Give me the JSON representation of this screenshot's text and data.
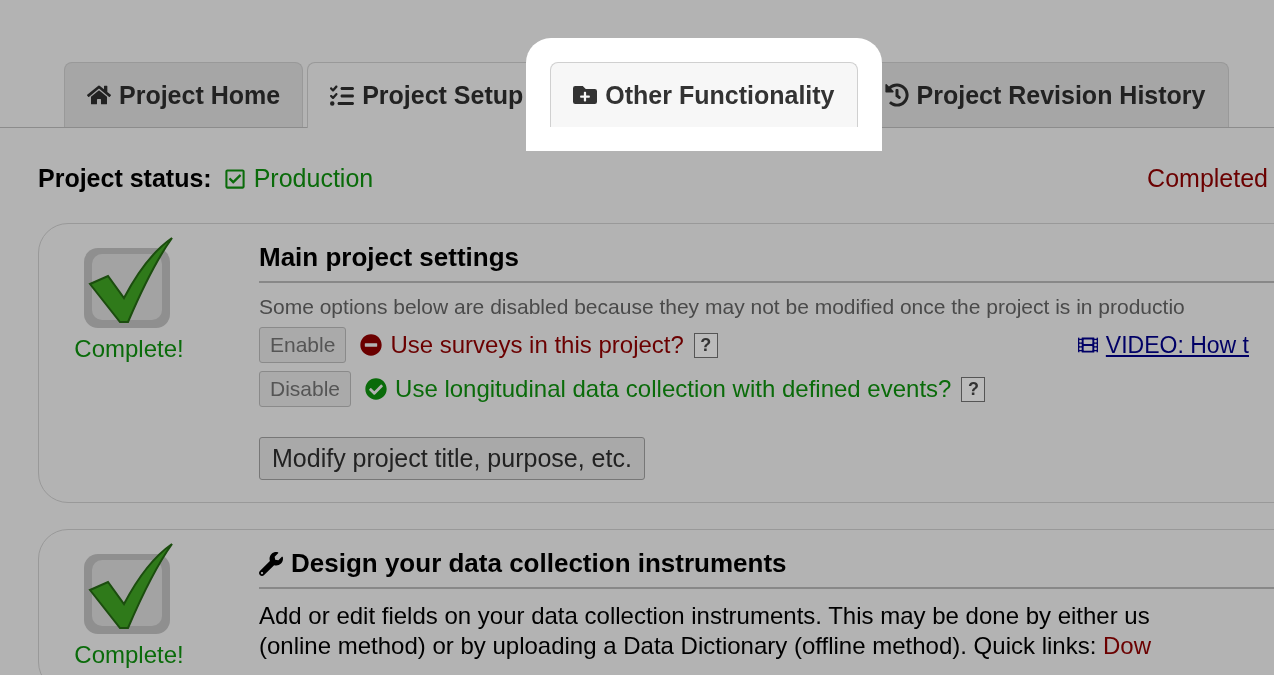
{
  "tabs": [
    {
      "label": "Project Home",
      "selected": false,
      "highlighted": false
    },
    {
      "label": "Project Setup",
      "selected": true,
      "highlighted": false
    },
    {
      "label": "Other Functionality",
      "selected": false,
      "highlighted": true
    },
    {
      "label": "Project Revision History",
      "selected": false,
      "highlighted": false
    }
  ],
  "project_status": {
    "label": "Project status:",
    "value": "Production"
  },
  "completed_label": "Completed",
  "main_settings": {
    "status": "Complete!",
    "title": "Main project settings",
    "note": "Some options below are disabled because they may not be modified once the project is in productio",
    "options": [
      {
        "button": "Enable",
        "disabled": true,
        "enabled": false,
        "text": "Use surveys in this project?",
        "help": "?"
      },
      {
        "button": "Disable",
        "disabled": true,
        "enabled": true,
        "text": "Use longitudinal data collection with defined events?",
        "help": "?"
      }
    ],
    "video_link": "VIDEO: How t",
    "modify_button": "Modify project title, purpose, etc."
  },
  "design_instruments": {
    "status": "Complete!",
    "title": "Design your data collection instruments",
    "lines": [
      "Add or edit fields on your data collection instruments. This may be done by either us",
      "(online method) or by uploading a Data Dictionary (offline method). Quick links: "
    ],
    "quick_link": "Dow"
  }
}
